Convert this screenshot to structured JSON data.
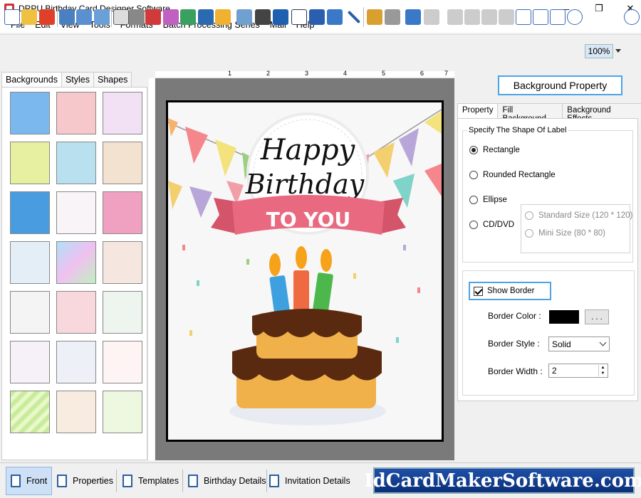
{
  "window": {
    "title": "DRPU Birthday Card Designer Software"
  },
  "menu": [
    "File",
    "Edit",
    "View",
    "Tools",
    "Formats",
    "Batch Processing Series",
    "Mail",
    "Help"
  ],
  "toolbar": {
    "zoom": "100%"
  },
  "left_tabs": [
    "Backgrounds",
    "Styles",
    "Shapes"
  ],
  "ruler_marks": [
    "1",
    "2",
    "3",
    "4",
    "5",
    "6",
    "7"
  ],
  "card": {
    "line1": "Happy",
    "line2": "Birthday",
    "ribbon": "TO YOU"
  },
  "right": {
    "header_button": "Background Property",
    "tabs": [
      "Property",
      "Fill Background",
      "Background Effects"
    ],
    "shape_group_label": "Specify The Shape Of Label",
    "shapes": [
      "Rectangle",
      "Rounded Rectangle",
      "Ellipse",
      "CD/DVD"
    ],
    "cd_sizes": [
      "Standard Size (120 * 120)",
      "Mini Size (80 * 80)"
    ],
    "show_border": "Show Border",
    "border_color_label": "Border Color :",
    "dots_button": ". . .",
    "border_style_label": "Border Style :",
    "border_style_value": "Solid",
    "border_width_label": "Border Width :",
    "border_width_value": "2"
  },
  "bottom_tabs": [
    "Front",
    "Properties",
    "Templates",
    "Birthday Details",
    "Invitation Details"
  ],
  "banner": "IdCardMakerSoftware.com",
  "colors": {
    "accent": "#4da3e6",
    "banner": "#1d4fa8",
    "ribbon": "#e96a80"
  }
}
